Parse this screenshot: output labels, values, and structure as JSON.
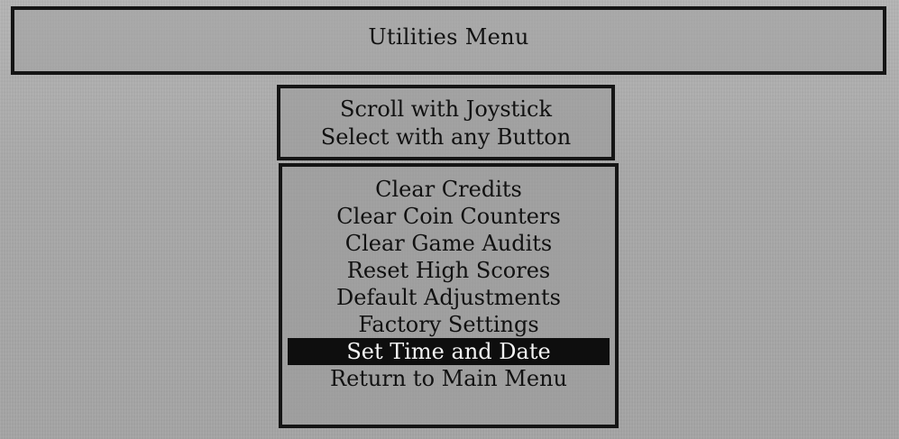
{
  "header": {
    "title": "Utilities Menu"
  },
  "instructions": {
    "line1": "Scroll with Joystick",
    "line2": "Select with any Button"
  },
  "menu": {
    "items": [
      {
        "label": "Clear Credits",
        "selected": false
      },
      {
        "label": "Clear Coin Counters",
        "selected": false
      },
      {
        "label": "Clear Game Audits",
        "selected": false
      },
      {
        "label": "Reset High Scores",
        "selected": false
      },
      {
        "label": "Default Adjustments",
        "selected": false
      },
      {
        "label": "Factory Settings",
        "selected": false
      },
      {
        "label": "Set Time and Date",
        "selected": true
      },
      {
        "label": "Return to Main Menu",
        "selected": false
      }
    ]
  },
  "colors": {
    "background": "#a9a9a9",
    "border": "#151515",
    "highlight_bg": "#0e0e0e",
    "highlight_text": "#f4f4f4"
  }
}
